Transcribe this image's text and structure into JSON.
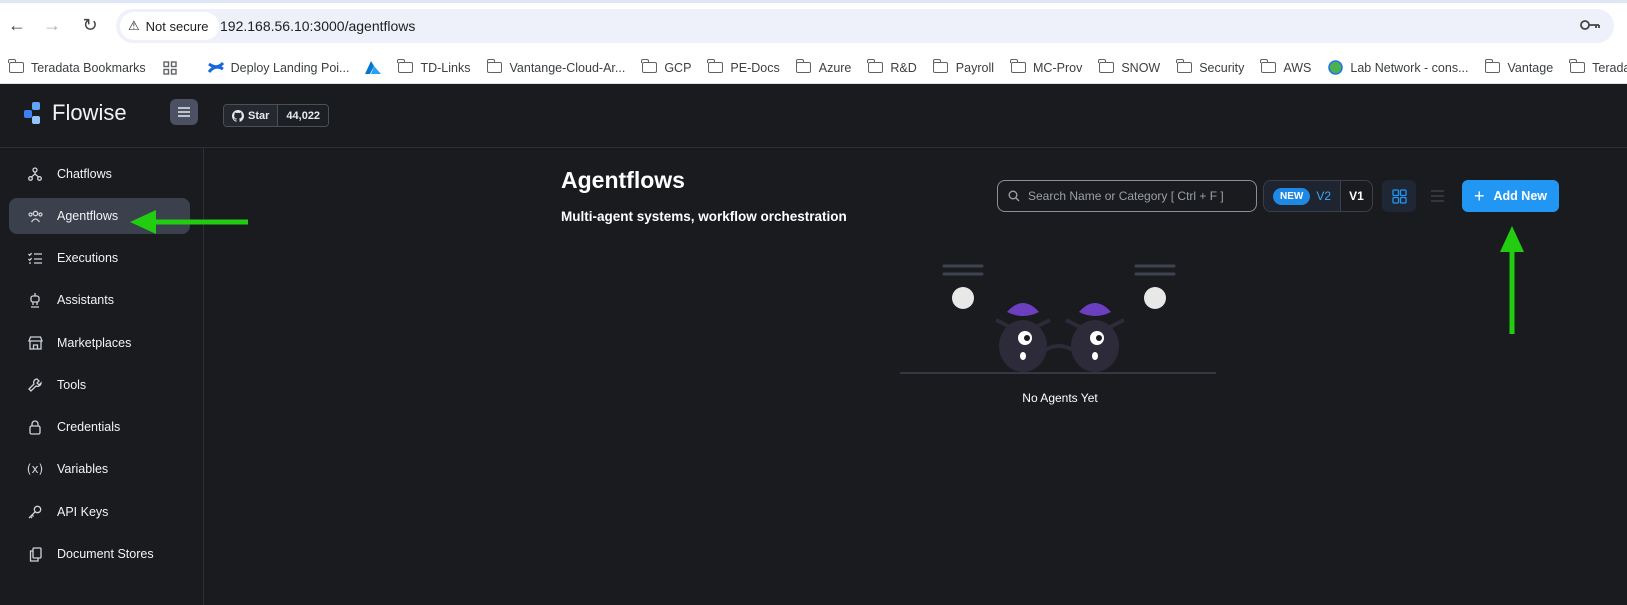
{
  "browser": {
    "security_label": "Not secure",
    "url": "192.168.56.10:3000/agentflows",
    "bookmarks": [
      {
        "label": "Teradata Bookmarks",
        "icon": "settings-folder-icon"
      },
      {
        "label": "",
        "icon": "apps-grid-icon"
      },
      {
        "label": "Deploy Landing Poi...",
        "icon": "confluence-icon"
      },
      {
        "label": "",
        "icon": "azure-icon"
      },
      {
        "label": "TD-Links",
        "icon": "folder-icon"
      },
      {
        "label": "Vantange-Cloud-Ar...",
        "icon": "folder-icon"
      },
      {
        "label": "GCP",
        "icon": "folder-icon"
      },
      {
        "label": "PE-Docs",
        "icon": "folder-icon"
      },
      {
        "label": "Azure",
        "icon": "folder-icon"
      },
      {
        "label": "R&D",
        "icon": "folder-icon"
      },
      {
        "label": "Payroll",
        "icon": "folder-icon"
      },
      {
        "label": "MC-Prov",
        "icon": "folder-icon"
      },
      {
        "label": "SNOW",
        "icon": "folder-icon"
      },
      {
        "label": "Security",
        "icon": "folder-icon"
      },
      {
        "label": "AWS",
        "icon": "folder-icon"
      },
      {
        "label": "Lab Network - cons...",
        "icon": "globe-icon"
      },
      {
        "label": "Vantage",
        "icon": "folder-icon"
      },
      {
        "label": "Teradata",
        "icon": "folder-icon"
      }
    ]
  },
  "header": {
    "logo_text": "Flowise",
    "github": {
      "star_label": "Star",
      "star_count": "44,022"
    }
  },
  "sidebar": {
    "items": [
      {
        "label": "Chatflows",
        "icon": "chatflows-icon",
        "active": false
      },
      {
        "label": "Agentflows",
        "icon": "agentflows-icon",
        "active": true
      },
      {
        "label": "Executions",
        "icon": "executions-icon",
        "active": false
      },
      {
        "label": "Assistants",
        "icon": "assistants-icon",
        "active": false
      },
      {
        "label": "Marketplaces",
        "icon": "marketplaces-icon",
        "active": false
      },
      {
        "label": "Tools",
        "icon": "tools-icon",
        "active": false
      },
      {
        "label": "Credentials",
        "icon": "lock-icon",
        "active": false
      },
      {
        "label": "Variables",
        "icon": "variables-icon",
        "active": false
      },
      {
        "label": "API Keys",
        "icon": "key-icon",
        "active": false
      },
      {
        "label": "Document Stores",
        "icon": "document-stores-icon",
        "active": false
      }
    ]
  },
  "main": {
    "title": "Agentflows",
    "subtitle": "Multi-agent systems, workflow orchestration",
    "search_placeholder": "Search Name or Category [ Ctrl + F ]",
    "version_toggle": {
      "new_badge": "NEW",
      "v2": "V2",
      "v1": "V1"
    },
    "add_button": "Add New",
    "empty_text": "No Agents Yet"
  },
  "colors": {
    "background": "#191b1f",
    "accent": "#2196f3",
    "active_item": "#3a404c",
    "annotation_arrow": "#22cc11"
  }
}
